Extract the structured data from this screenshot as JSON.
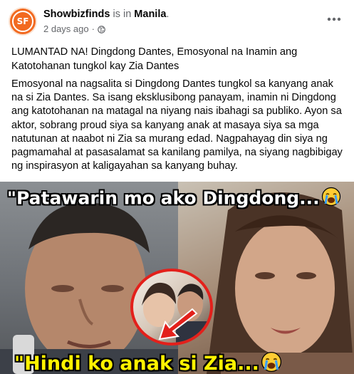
{
  "post": {
    "page_name": "Showbizfinds",
    "checkin_text": "is in",
    "place": "Manila",
    "place_suffix": ".",
    "timestamp": "2 days ago",
    "separator": "·",
    "avatar_text": "SF",
    "privacy_icon": "globe-icon",
    "more_icon": "more-options-icon",
    "title": "LUMANTAD NA! Dingdong Dantes, Emosyonal na Inamin ang Katotohanan tungkol kay Zia Dantes",
    "body": "Emosyonal na nagsalita si Dingdong Dantes tungkol sa kanyang anak na si Zia Dantes. Sa isang eksklusibong panayam, inamin ni Dingdong ang katotohanan na matagal na niyang nais ibahagi sa publiko. Ayon sa aktor, sobrang proud siya sa kanyang anak at masaya siya sa mga natutunan at naabot ni Zia sa murang edad. Nagpahayag din siya ng pagmamahal at pasasalamat sa kanilang pamilya, na siyang nagbibigay ng inspirasyon at kaligayahan sa kanyang buhay."
  },
  "image": {
    "caption_top": "\"Patawarin mo ako Dingdong...",
    "caption_bottom": "\"Hindi ko anak si Zia...",
    "emoji_icon": "crying-face-icon"
  },
  "colors": {
    "brand": "#f26a21",
    "caption_top": "#ffffff",
    "caption_bottom": "#fff200",
    "inset_border": "#e3201b",
    "secondary_text": "#65676b"
  }
}
